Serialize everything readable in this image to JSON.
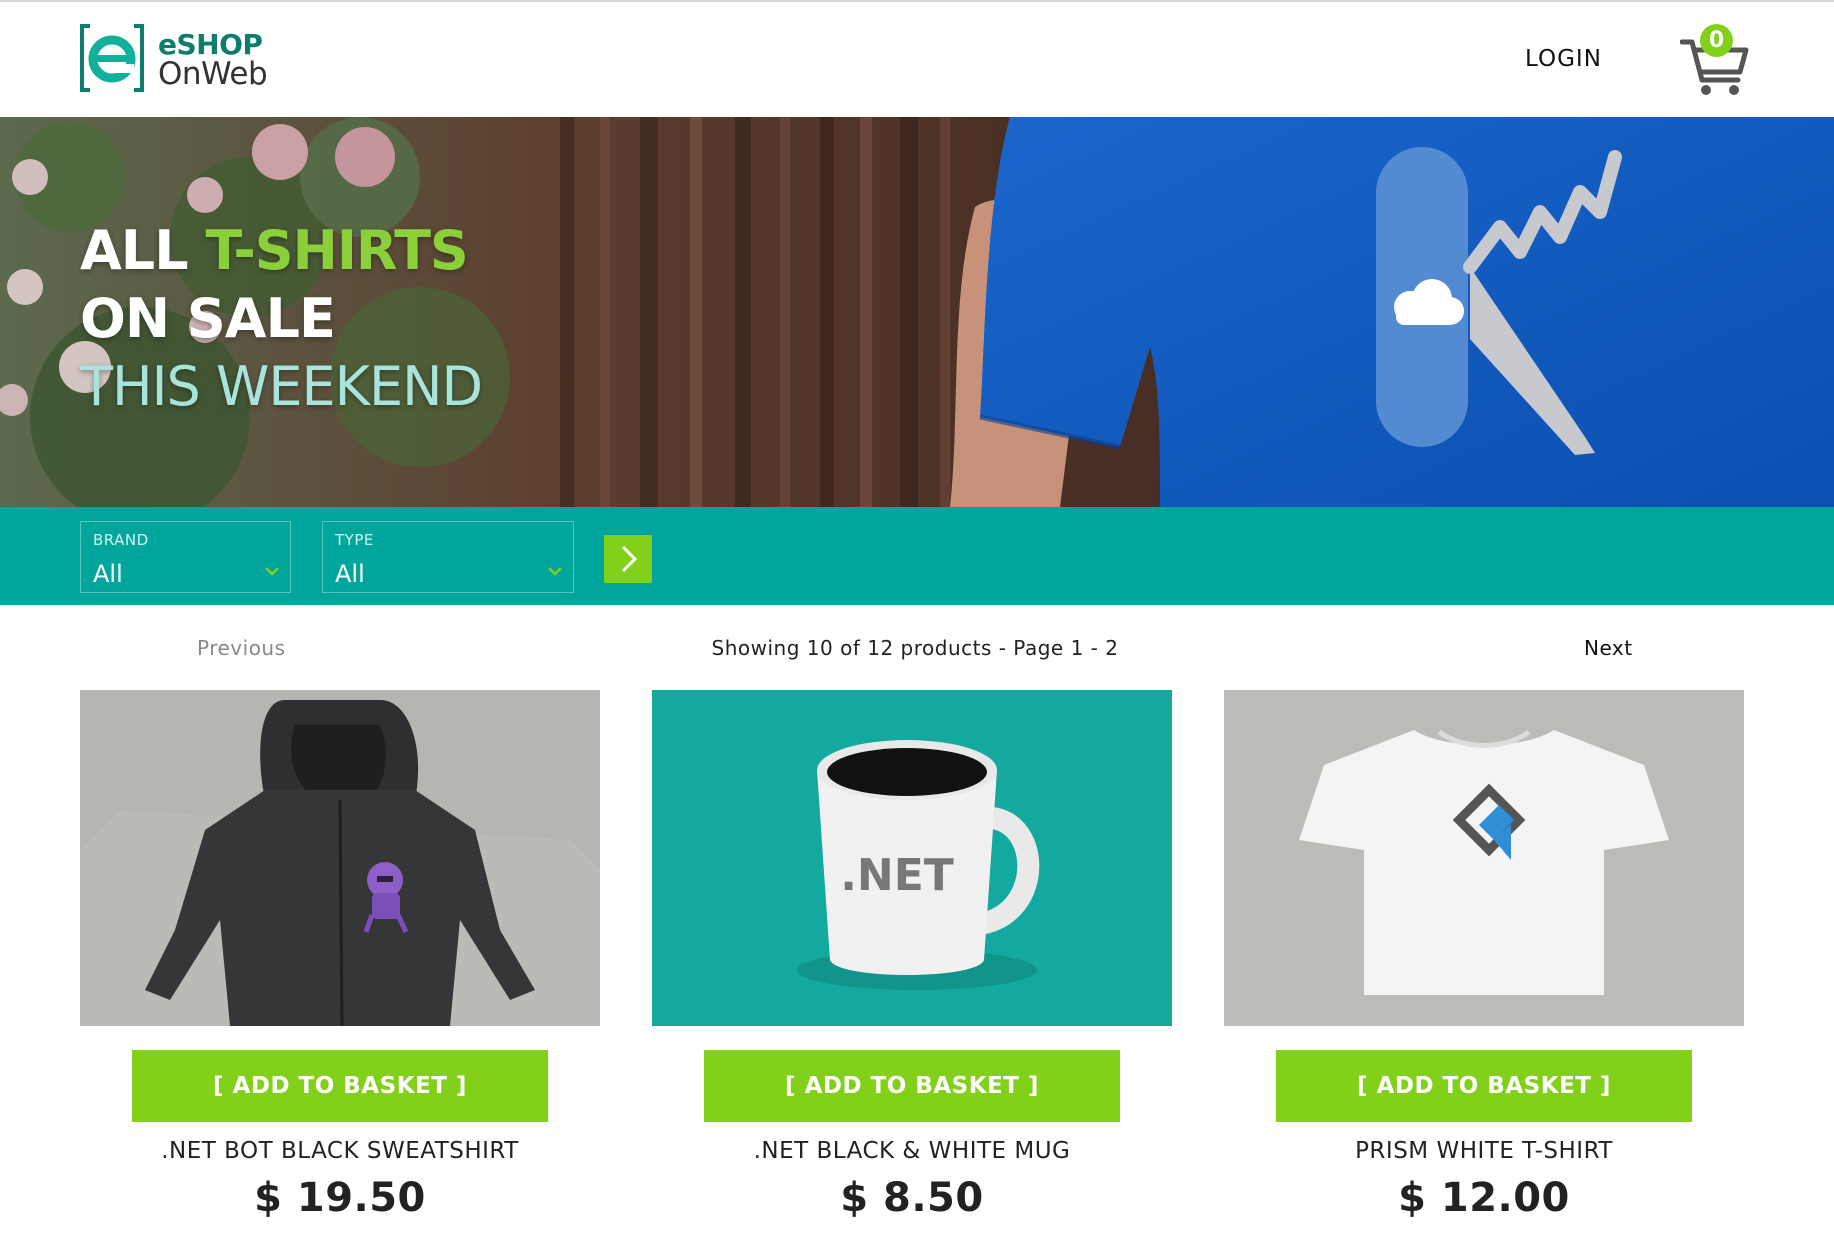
{
  "header": {
    "logo_line1": "eSHOP",
    "logo_line2": "OnWeb",
    "login_label": "LOGIN",
    "cart_count": "0"
  },
  "hero": {
    "line1_white": "ALL",
    "line1_accent": "T-SHIRTS",
    "line2": "ON SALE",
    "line3": "THIS WEEKEND"
  },
  "filters": {
    "brand_label": "BRAND",
    "brand_value": "All",
    "type_label": "TYPE",
    "type_value": "All"
  },
  "pager": {
    "previous_label": "Previous",
    "info": "Showing 10 of 12 products - Page 1 - 2",
    "next_label": "Next"
  },
  "products": [
    {
      "name": ".NET BOT BLACK SWEATSHIRT",
      "price": "$ 19.50",
      "button_label": "[ ADD TO BASKET ]"
    },
    {
      "name": ".NET BLACK & WHITE MUG",
      "price": "$ 8.50",
      "button_label": "[ ADD TO BASKET ]",
      "mug_text": ".NET"
    },
    {
      "name": "PRISM WHITE T-SHIRT",
      "price": "$ 12.00",
      "button_label": "[ ADD TO BASKET ]"
    }
  ],
  "colors": {
    "teal": "#00a69c",
    "green": "#83d01b",
    "logo_teal": "#0f7d6e"
  }
}
